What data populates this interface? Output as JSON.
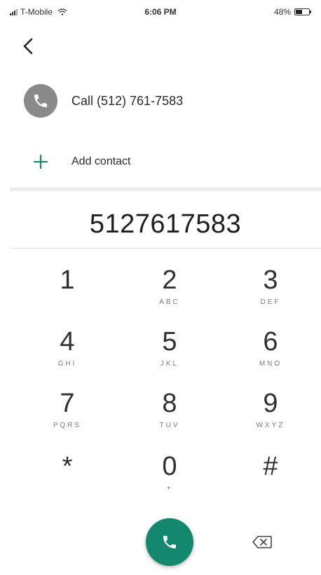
{
  "status_bar": {
    "carrier": "T-Mobile",
    "time": "6:06 PM",
    "battery": "48%",
    "battery_level": 0.48,
    "signal_icon": "cellular-signal-icon",
    "wifi_icon": "wifi-icon"
  },
  "nav": {
    "back_icon": "chevron-left-icon"
  },
  "suggestions": {
    "call_label": "Call (512) 761-7583",
    "call_icon": "phone-icon",
    "add_contact_label": "Add contact",
    "add_icon": "plus-icon"
  },
  "dialed_number": "5127617583",
  "keypad": [
    {
      "digit": "1",
      "letters": ""
    },
    {
      "digit": "2",
      "letters": "ABC"
    },
    {
      "digit": "3",
      "letters": "DEF"
    },
    {
      "digit": "4",
      "letters": "GHI"
    },
    {
      "digit": "5",
      "letters": "JKL"
    },
    {
      "digit": "6",
      "letters": "MNO"
    },
    {
      "digit": "7",
      "letters": "PQRS"
    },
    {
      "digit": "8",
      "letters": "TUV"
    },
    {
      "digit": "9",
      "letters": "WXYZ"
    },
    {
      "digit": "*",
      "letters": ""
    },
    {
      "digit": "0",
      "letters": "+"
    },
    {
      "digit": "#",
      "letters": ""
    }
  ],
  "actions": {
    "call_icon": "phone-icon",
    "backspace_icon": "backspace-icon"
  },
  "colors": {
    "accent": "#14876f",
    "avatar_grey": "#8a8a8a"
  }
}
